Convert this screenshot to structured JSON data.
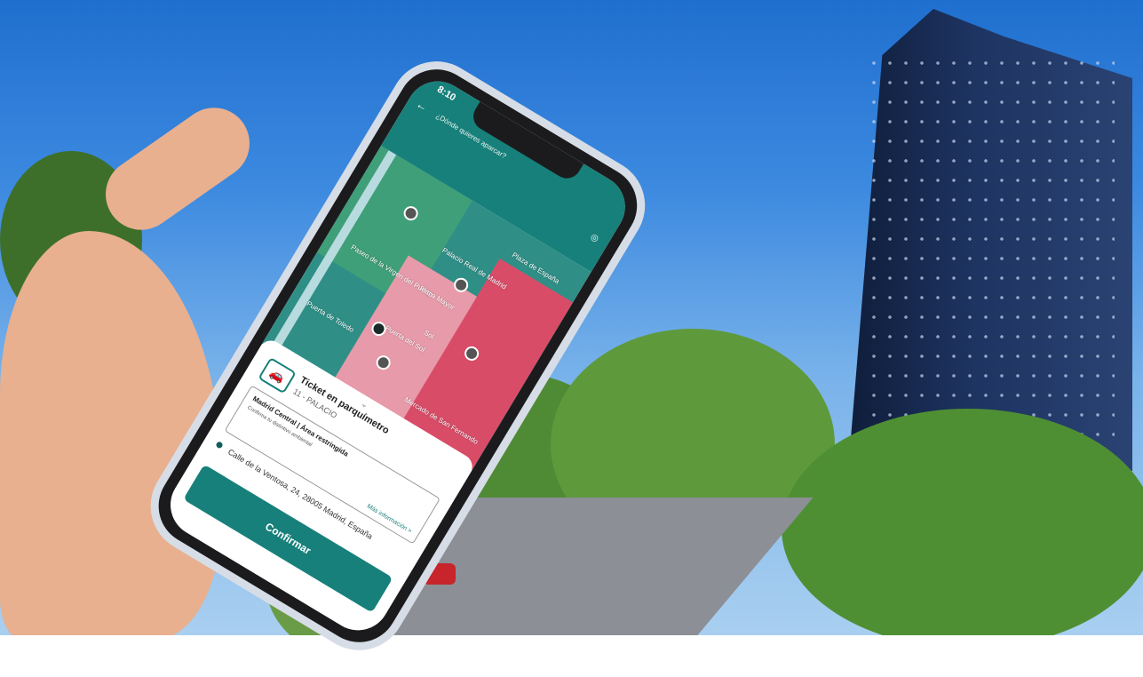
{
  "app": {
    "status_time": "8:10",
    "search_placeholder": "¿Dónde quieres aparcar?",
    "map_labels": [
      "Puerta de Toledo",
      "Palacio Real de Madrid",
      "Plaza Mayor",
      "Plaza de España",
      "Puerta del Sol",
      "Mercado de San Fernando",
      "Paseo de la Virgen del Puerto",
      "Sol"
    ],
    "ticket": {
      "title": "Ticket en parquímetro",
      "subtitle": "11 - PALACIO",
      "zone_tag": "Madrid Central | Área restringida",
      "zone_note": "Confirma tu distintivo ambiental",
      "more_info": "Más información >"
    },
    "address": "Calle de la Ventosa, 24, 28005 Madrid, España",
    "confirm_label": "Confirmar"
  },
  "colors": {
    "brand_teal": "#17807a",
    "zone_pink": "#e79aa9",
    "zone_red": "#d94c68",
    "sky": "#3d8ae0"
  }
}
